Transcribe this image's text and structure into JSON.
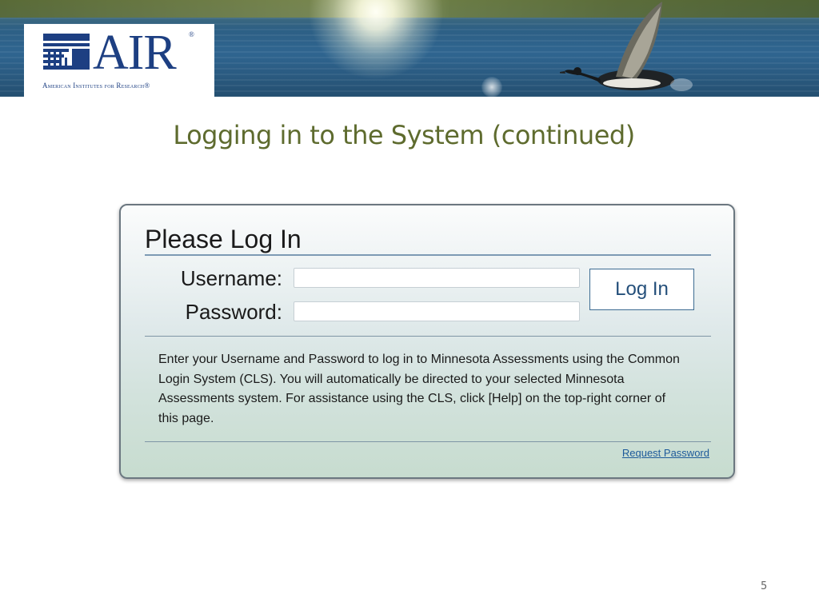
{
  "header": {
    "logo": {
      "icon": "columns-building-icon",
      "word": "AIR",
      "registered": "®",
      "subtitle": "American Institutes for Research®"
    }
  },
  "slide": {
    "title": "Logging in to the System (continued)",
    "page_number": "5"
  },
  "login_panel": {
    "heading": "Please Log In",
    "username_label": "Username:",
    "username_value": "",
    "password_label": "Password:",
    "password_value": "",
    "login_button": "Log In",
    "instructions": "Enter your Username and Password to log in to Minnesota Assessments using the Common Login System (CLS). You will automatically be directed to your selected Minnesota Assessments system. For assistance using the CLS, click [Help] on the top-right corner of this page.",
    "request_password_link": "Request Password"
  },
  "colors": {
    "logo_blue": "#1d3f82",
    "title_olive": "#5e6b2e",
    "button_text": "#244f7a",
    "link": "#1d5a9a"
  }
}
